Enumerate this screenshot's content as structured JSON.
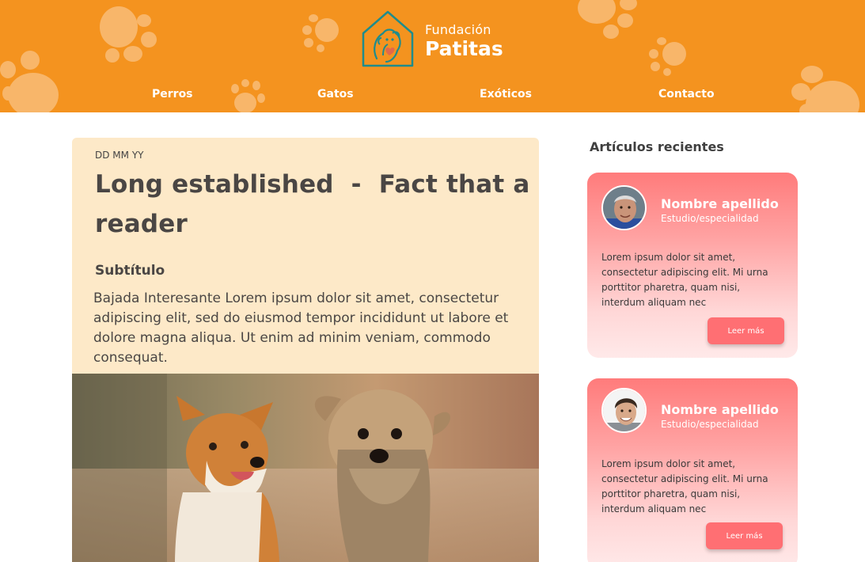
{
  "brand": {
    "name_line1": "Fundación",
    "name_line2": "Patitas",
    "header_color": "#f4931f"
  },
  "nav": [
    {
      "label": "Perros"
    },
    {
      "label": "Gatos"
    },
    {
      "label": "Exóticos"
    },
    {
      "label": "Contacto"
    }
  ],
  "article": {
    "date": "DD MM YY",
    "title": "Long established  -  Fact that a reader",
    "subtitle": "Subtítulo",
    "body": "Bajada Interesante Lorem ipsum dolor sit amet, consectetur adipiscing elit, sed do eiusmod tempor incididunt ut labore et dolore magna aliqua. Ut enim ad minim veniam, commodo consequat.",
    "image": "two-dogs-photo"
  },
  "sidebar": {
    "title": "Artículos recientes",
    "cards": [
      {
        "name": "Nombre apellido",
        "role": "Estudio/especialidad",
        "text": "Lorem ipsum dolor sit amet, consectetur adipiscing elit. Mi urna porttitor pharetra, quam nisi, interdum aliquam nec",
        "button": "Leer más"
      },
      {
        "name": "Nombre apellido",
        "role": "Estudio/especialidad",
        "text": "Lorem ipsum dolor sit amet, consectetur adipiscing elit. Mi urna porttitor pharetra, quam nisi, interdum aliquam nec",
        "button": "Leer más"
      }
    ]
  },
  "colors": {
    "accent": "#f4931f",
    "card_top": "#ff7b7b",
    "button": "#ff6f73",
    "article_bg": "#fde9c8"
  }
}
